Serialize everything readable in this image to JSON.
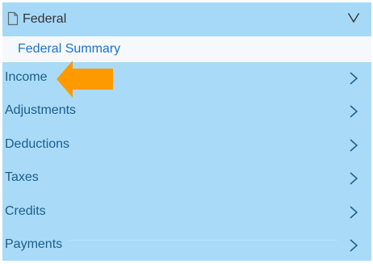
{
  "header": {
    "title": "Federal",
    "doc_icon": "document-icon",
    "collapse_icon": "chevron-down-icon"
  },
  "summary": {
    "label": "Federal Summary"
  },
  "nav": {
    "items": [
      {
        "label": "Income",
        "icon": "chevron-right-icon"
      },
      {
        "label": "Adjustments",
        "icon": "chevron-right-icon"
      },
      {
        "label": "Deductions",
        "icon": "chevron-right-icon"
      },
      {
        "label": "Taxes",
        "icon": "chevron-right-icon"
      },
      {
        "label": "Credits",
        "icon": "chevron-right-icon"
      },
      {
        "label": "Payments",
        "icon": "chevron-right-icon"
      }
    ]
  },
  "colors": {
    "panel_bg": "#a9dbf8",
    "summary_bg": "#f6f9fc",
    "link_blue": "#1a73c9",
    "nav_text": "#1d5d8a",
    "pointer_orange": "#ff9900"
  }
}
